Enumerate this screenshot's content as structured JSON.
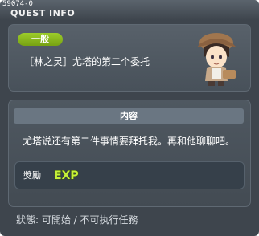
{
  "window": {
    "quest_id": "59074-0",
    "title": "QUEST INFO"
  },
  "quest": {
    "category_badge": "一般",
    "name": "［林之灵］尤塔的第二个委托",
    "npc_icon": "npc-portrait-icon"
  },
  "content": {
    "header": "内容",
    "description": "尤塔说还有第二件事情要拜托我。再和他聊聊吧。",
    "reward_label": "獎勵",
    "reward_icon_text": "EXP"
  },
  "status": {
    "text": "狀態: 可開始 / 不可执行任務"
  }
}
